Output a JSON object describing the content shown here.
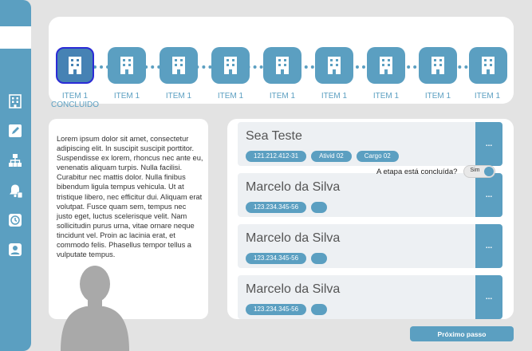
{
  "sidebar": {
    "icons": [
      "building-icon",
      "edit-icon",
      "org-chart-icon",
      "bell-icon",
      "history-icon",
      "user-icon"
    ]
  },
  "steps": [
    {
      "label": "ITEM 1 CONCLUIDO",
      "active": true
    },
    {
      "label": "ITEM 1",
      "active": false
    },
    {
      "label": "ITEM 1",
      "active": false
    },
    {
      "label": "ITEM 1",
      "active": false
    },
    {
      "label": "ITEM 1",
      "active": false
    },
    {
      "label": "ITEM 1",
      "active": false
    },
    {
      "label": "ITEM 1",
      "active": false
    },
    {
      "label": "ITEM 1",
      "active": false
    },
    {
      "label": "ITEM 1",
      "active": false
    }
  ],
  "description": "Lorem ipsum dolor sit amet, consectetur adipiscing elit. In suscipit suscipit porttitor. Suspendisse ex lorem, rhoncus nec ante eu, venenatis aliquam turpis. Nulla facilisi. Curabitur nec mattis dolor. Nulla finibus bibendum ligula tempus vehicula. Ut at tristique libero, nec efficitur dui. Aliquam erat volutpat. Fusce quam sem, tempus nec justo eget, luctus scelerisque velit. Nam sollicitudin purus urna, vitae ornare neque tincidunt vel. Proin ac lacinia erat, et commodo felis. Phasellus tempor tellus a vulputate tempus.",
  "cards": [
    {
      "name": "Sea Teste",
      "chips": [
        "121.212.412-31",
        "Ativid 02",
        "Cargo 02"
      ],
      "more": "..."
    },
    {
      "name": "Marcelo da Silva",
      "chips": [
        "123.234.345-56",
        ""
      ],
      "more": "..."
    },
    {
      "name": "Marcelo da Silva",
      "chips": [
        "123.234.345-56",
        ""
      ],
      "more": "..."
    },
    {
      "name": "Marcelo da Silva",
      "chips": [
        "123.234.345-56",
        ""
      ],
      "more": "..."
    }
  ],
  "completion": {
    "question": "A etapa está concluída?",
    "toggle_label": "Sim",
    "value": true
  },
  "next_button": "Próximo passo",
  "colors": {
    "accent": "#5b9fc1",
    "active_step": "#4682b4",
    "background": "#e3e3e3"
  }
}
